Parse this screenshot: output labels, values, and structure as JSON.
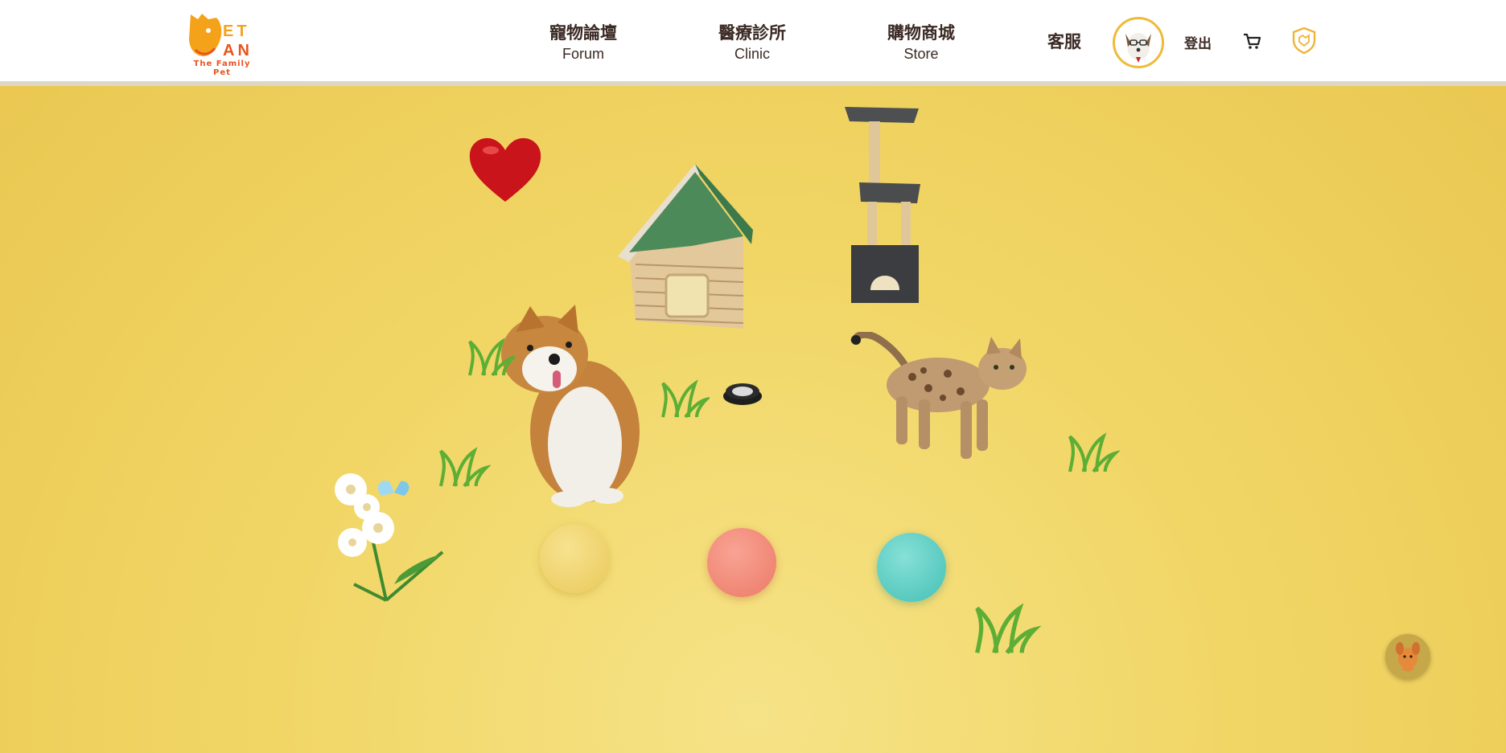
{
  "brand": {
    "logo_letters_top": "ET",
    "logo_letters_bottom": "AN",
    "tagline": "The Family Pet",
    "primary_color": "#f5a21b",
    "accent_color": "#e8541e"
  },
  "nav": {
    "items": [
      {
        "zh": "寵物論壇",
        "en": "Forum"
      },
      {
        "zh": "醫療診所",
        "en": "Clinic"
      },
      {
        "zh": "購物商城",
        "en": "Store"
      }
    ],
    "service_label": "客服",
    "logout_label": "登出"
  },
  "icons": {
    "avatar": "dog-avatar-icon",
    "cart": "shopping-cart-icon",
    "badge": "shield-badge-icon",
    "helper": "dog-helper-icon"
  },
  "scene": {
    "background_color": "#f1d666",
    "ball_colors": [
      "#f2d770",
      "#f38c7a",
      "#5fcfc4"
    ]
  }
}
